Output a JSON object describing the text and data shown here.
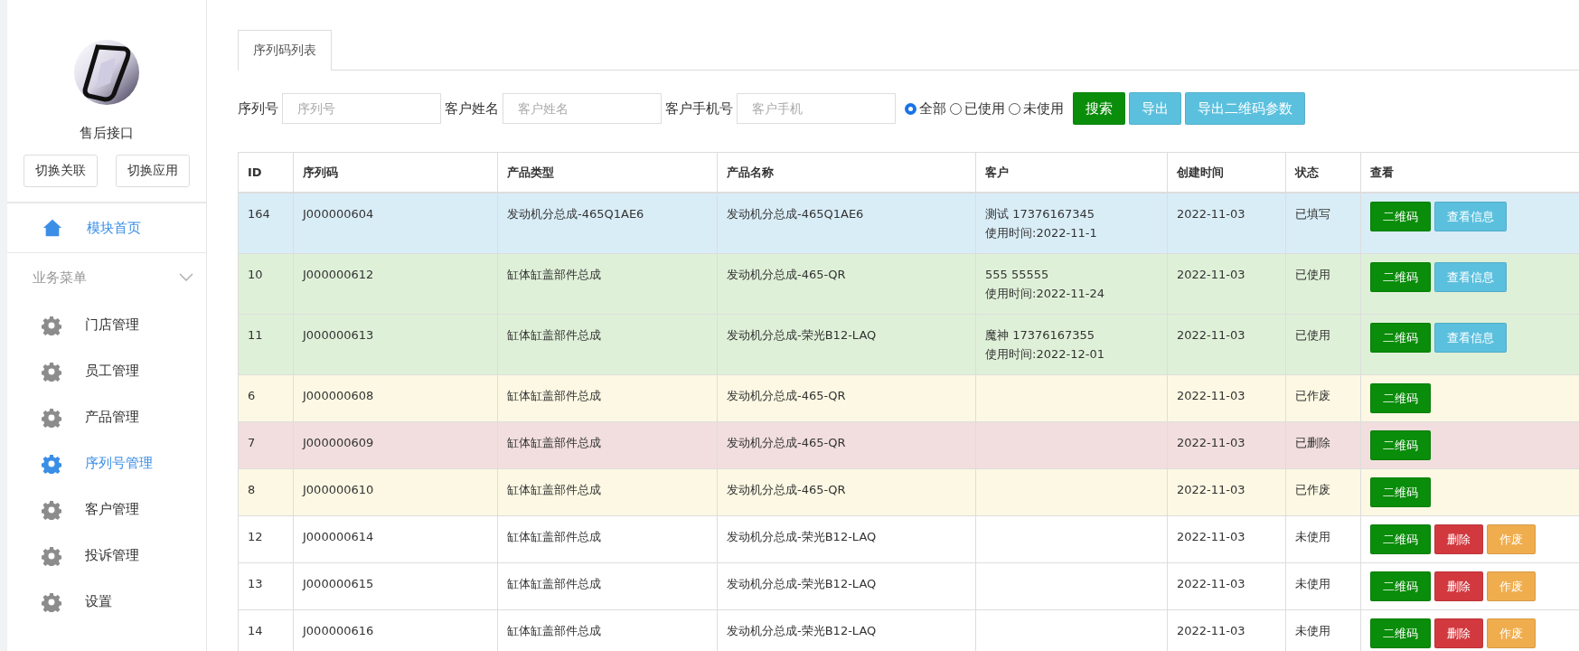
{
  "sidebar": {
    "title": "售后接口",
    "buttons": [
      "切换关联",
      "切换应用"
    ],
    "home": {
      "label": "模块首页",
      "selected": true
    },
    "section": {
      "label": "业务菜单",
      "expanded": true
    },
    "items": [
      {
        "label": "门店管理",
        "selected": false
      },
      {
        "label": "员工管理",
        "selected": false
      },
      {
        "label": "产品管理",
        "selected": false
      },
      {
        "label": "序列号管理",
        "selected": true
      },
      {
        "label": "客户管理",
        "selected": false
      },
      {
        "label": "投诉管理",
        "selected": false
      },
      {
        "label": "设置",
        "selected": false
      }
    ]
  },
  "tabs": [
    {
      "label": "序列码列表",
      "selected": true
    }
  ],
  "filters": {
    "fields": [
      {
        "label": "序列号",
        "placeholder": "序列号"
      },
      {
        "label": "客户姓名",
        "placeholder": "客户姓名"
      },
      {
        "label": "客户手机号",
        "placeholder": "客户手机"
      }
    ],
    "radios": [
      {
        "label": "全部",
        "selected": true
      },
      {
        "label": "已使用",
        "selected": false
      },
      {
        "label": "未使用",
        "selected": false
      }
    ],
    "buttons": [
      {
        "label": "搜索",
        "kind": "success"
      },
      {
        "label": "导出",
        "kind": "info"
      },
      {
        "label": "导出二维码参数",
        "kind": "info"
      }
    ]
  },
  "table": {
    "columns": [
      "ID",
      "序列码",
      "产品类型",
      "产品名称",
      "客户",
      "创建时间",
      "状态",
      "查看"
    ],
    "rows": [
      {
        "kind": "info",
        "id": "164",
        "serial": "J000000604",
        "type": "发动机分总成-465Q1AE6",
        "name": "发动机分总成-465Q1AE6",
        "customer": "测试 17376167345",
        "used_at": "使用时间:2022-11-1",
        "created": "2022-11-03",
        "status": "已填写",
        "actions": [
          {
            "label": "二维码",
            "kind": "success"
          },
          {
            "label": "查看信息",
            "kind": "info"
          }
        ]
      },
      {
        "kind": "success",
        "id": "10",
        "serial": "J000000612",
        "type": "缸体缸盖部件总成",
        "name": "发动机分总成-465-QR",
        "customer": "555 55555",
        "used_at": "使用时间:2022-11-24",
        "created": "2022-11-03",
        "status": "已使用",
        "actions": [
          {
            "label": "二维码",
            "kind": "success"
          },
          {
            "label": "查看信息",
            "kind": "info"
          }
        ]
      },
      {
        "kind": "success",
        "id": "11",
        "serial": "J000000613",
        "type": "缸体缸盖部件总成",
        "name": "发动机分总成-荣光B12-LAQ",
        "customer": "魔神 17376167355",
        "used_at": "使用时间:2022-12-01",
        "created": "2022-11-03",
        "status": "已使用",
        "actions": [
          {
            "label": "二维码",
            "kind": "success"
          },
          {
            "label": "查看信息",
            "kind": "info"
          }
        ]
      },
      {
        "kind": "warning",
        "id": "6",
        "serial": "J000000608",
        "type": "缸体缸盖部件总成",
        "name": "发动机分总成-465-QR",
        "created": "2022-11-03",
        "status": "已作废",
        "actions": [
          {
            "label": "二维码",
            "kind": "success"
          }
        ]
      },
      {
        "kind": "danger",
        "id": "7",
        "serial": "J000000609",
        "type": "缸体缸盖部件总成",
        "name": "发动机分总成-465-QR",
        "created": "2022-11-03",
        "status": "已删除",
        "actions": [
          {
            "label": "二维码",
            "kind": "success"
          }
        ]
      },
      {
        "kind": "warning",
        "id": "8",
        "serial": "J000000610",
        "type": "缸体缸盖部件总成",
        "name": "发动机分总成-465-QR",
        "created": "2022-11-03",
        "status": "已作废",
        "actions": [
          {
            "label": "二维码",
            "kind": "success"
          }
        ]
      },
      {
        "kind": "plain",
        "id": "12",
        "serial": "J000000614",
        "type": "缸体缸盖部件总成",
        "name": "发动机分总成-荣光B12-LAQ",
        "created": "2022-11-03",
        "status": "未使用",
        "actions": [
          {
            "label": "二维码",
            "kind": "success"
          },
          {
            "label": "删除",
            "kind": "danger"
          },
          {
            "label": "作废",
            "kind": "warning"
          }
        ]
      },
      {
        "kind": "plain",
        "id": "13",
        "serial": "J000000615",
        "type": "缸体缸盖部件总成",
        "name": "发动机分总成-荣光B12-LAQ",
        "created": "2022-11-03",
        "status": "未使用",
        "actions": [
          {
            "label": "二维码",
            "kind": "success"
          },
          {
            "label": "删除",
            "kind": "danger"
          },
          {
            "label": "作废",
            "kind": "warning"
          }
        ]
      },
      {
        "kind": "plain",
        "id": "14",
        "serial": "J000000616",
        "type": "缸体缸盖部件总成",
        "name": "发动机分总成-荣光B12-LAQ",
        "created": "2022-11-03",
        "status": "未使用",
        "actions": [
          {
            "label": "二维码",
            "kind": "success"
          },
          {
            "label": "删除",
            "kind": "danger"
          },
          {
            "label": "作废",
            "kind": "warning"
          }
        ]
      }
    ]
  }
}
